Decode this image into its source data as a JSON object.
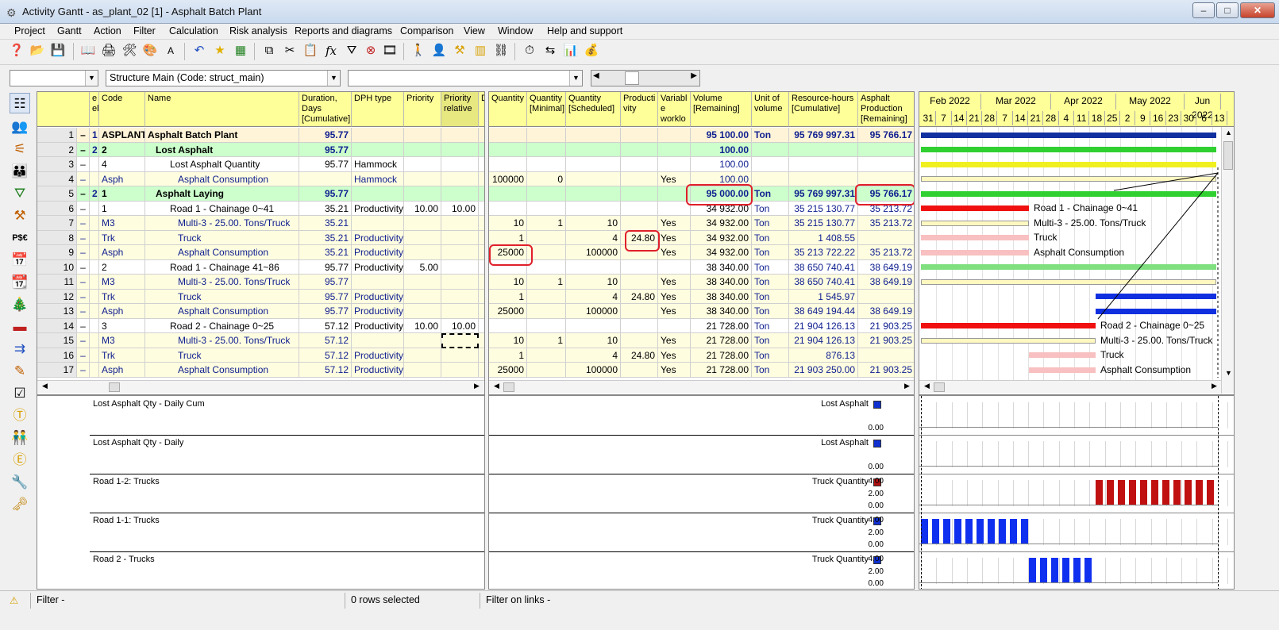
{
  "window": {
    "title": "Activity Gantt - as_plant_02 [1] - Asphalt Batch Plant",
    "min": "–",
    "max": "□",
    "close": "✕"
  },
  "menu": [
    "Project",
    "Gantt",
    "Action",
    "Filter",
    "Calculation",
    "Risk analysis",
    "Reports and diagrams",
    "Comparison",
    "View",
    "Window",
    "Help and support"
  ],
  "combos": {
    "first": "",
    "structure": "Structure Main (Code: struct_main)",
    "third": ""
  },
  "left_headers": {
    "lvl": "e\nel",
    "code": "Code",
    "name": "Name",
    "dur": "Duration,\nDays\n[Cumulative]",
    "dph": "DPH type",
    "prio": "Priority",
    "prio_rel": "Priority\nrelative",
    "d": "D"
  },
  "mid_headers": {
    "qty": "Quantity",
    "qmin": "Quantity\n[Minimal]",
    "qsch": "Quantity\n[Scheduled]",
    "prod": "Producti\nvity",
    "var": "Variabl\ne\nworklo",
    "vol": "Volume\n[Remaining]",
    "unit": "Unit of\nvolume",
    "rh": "Resource-hours\n[Cumulative]",
    "ap": "Asphalt\nProduction\n[Remaining]"
  },
  "gantt": {
    "months": [
      "Feb 2022",
      "Mar 2022",
      "Apr 2022",
      "May 2022",
      "Jun 2022"
    ],
    "days": [
      "31",
      "7",
      "14",
      "21",
      "28",
      "7",
      "14",
      "21",
      "28",
      "4",
      "11",
      "18",
      "25",
      "2",
      "9",
      "16",
      "23",
      "30",
      "6",
      "13"
    ]
  },
  "rows": [
    {
      "n": "1",
      "lvl": "1",
      "c": "ASPLANT",
      "name": "Asphalt Batch Plant",
      "dur": "95.77",
      "dph": "",
      "p": "",
      "pr": "",
      "q": "",
      "qm": "",
      "qs": "",
      "pv": "",
      "v": "",
      "vol": "95 100.00",
      "u": "Ton",
      "rh": "95 769 997.31",
      "ap": "95 766.17"
    },
    {
      "n": "2",
      "lvl": "2",
      "c": "2",
      "name": "Lost Asphalt",
      "dur": "95.77",
      "dph": "",
      "p": "",
      "pr": "",
      "q": "",
      "qm": "",
      "qs": "",
      "pv": "",
      "v": "",
      "vol": "100.00",
      "u": "",
      "rh": "",
      "ap": ""
    },
    {
      "n": "3",
      "lvl": "",
      "c": "4",
      "name": "Lost Asphalt Quantity",
      "dur": "95.77",
      "dph": "Hammock",
      "p": "",
      "pr": "",
      "q": "",
      "qm": "",
      "qs": "",
      "pv": "",
      "v": "",
      "vol": "100.00",
      "u": "",
      "rh": "",
      "ap": ""
    },
    {
      "n": "4",
      "lvl": "",
      "c": "Asph",
      "name": "Asphalt Consumption",
      "dur": "",
      "dph": "Hammock",
      "p": "",
      "pr": "",
      "q": "100000",
      "qm": "0",
      "qs": "",
      "pv": "",
      "v": "Yes",
      "vol": "100.00",
      "u": "",
      "rh": "",
      "ap": ""
    },
    {
      "n": "5",
      "lvl": "2",
      "c": "1",
      "name": "Asphalt Laying",
      "dur": "95.77",
      "dph": "",
      "p": "",
      "pr": "",
      "q": "",
      "qm": "",
      "qs": "",
      "pv": "",
      "v": "",
      "vol": "95 000.00",
      "u": "Ton",
      "rh": "95 769 997.31",
      "ap": "95 766.17"
    },
    {
      "n": "6",
      "lvl": "",
      "c": "1",
      "name": "Road 1 - Chainage 0~41",
      "dur": "35.21",
      "dph": "Productivity",
      "p": "10.00",
      "pr": "10.00",
      "q": "",
      "qm": "",
      "qs": "",
      "pv": "",
      "v": "",
      "vol": "34 932.00",
      "u": "Ton",
      "rh": "35 215 130.77",
      "ap": "35 213.72"
    },
    {
      "n": "7",
      "lvl": "",
      "c": "M3",
      "name": "Multi-3 - 25.00. Tons/Truck",
      "dur": "35.21",
      "dph": "",
      "p": "",
      "pr": "",
      "q": "10",
      "qm": "1",
      "qs": "10",
      "pv": "",
      "v": "Yes",
      "vol": "34 932.00",
      "u": "Ton",
      "rh": "35 215 130.77",
      "ap": "35 213.72"
    },
    {
      "n": "8",
      "lvl": "",
      "c": "Trk",
      "name": "Truck",
      "dur": "35.21",
      "dph": "Productivity",
      "p": "",
      "pr": "",
      "q": "1",
      "qm": "",
      "qs": "4",
      "pv": "24.80",
      "v": "Yes",
      "vol": "34 932.00",
      "u": "Ton",
      "rh": "1 408.55",
      "ap": ""
    },
    {
      "n": "9",
      "lvl": "",
      "c": "Asph",
      "name": "Asphalt Consumption",
      "dur": "35.21",
      "dph": "Productivity",
      "p": "",
      "pr": "",
      "q": "25000",
      "qm": "",
      "qs": "100000",
      "pv": "",
      "v": "Yes",
      "vol": "34 932.00",
      "u": "Ton",
      "rh": "35 213 722.22",
      "ap": "35 213.72"
    },
    {
      "n": "10",
      "lvl": "",
      "c": "2",
      "name": "Road 1 - Chainage 41~86",
      "dur": "95.77",
      "dph": "Productivity",
      "p": "5.00",
      "pr": "",
      "q": "",
      "qm": "",
      "qs": "",
      "pv": "",
      "v": "",
      "vol": "38 340.00",
      "u": "Ton",
      "rh": "38 650 740.41",
      "ap": "38 649.19"
    },
    {
      "n": "11",
      "lvl": "",
      "c": "M3",
      "name": "Multi-3 - 25.00. Tons/Truck",
      "dur": "95.77",
      "dph": "",
      "p": "",
      "pr": "",
      "q": "10",
      "qm": "1",
      "qs": "10",
      "pv": "",
      "v": "Yes",
      "vol": "38 340.00",
      "u": "Ton",
      "rh": "38 650 740.41",
      "ap": "38 649.19"
    },
    {
      "n": "12",
      "lvl": "",
      "c": "Trk",
      "name": "Truck",
      "dur": "95.77",
      "dph": "Productivity",
      "p": "",
      "pr": "",
      "q": "1",
      "qm": "",
      "qs": "4",
      "pv": "24.80",
      "v": "Yes",
      "vol": "38 340.00",
      "u": "Ton",
      "rh": "1 545.97",
      "ap": ""
    },
    {
      "n": "13",
      "lvl": "",
      "c": "Asph",
      "name": "Asphalt Consumption",
      "dur": "95.77",
      "dph": "Productivity",
      "p": "",
      "pr": "",
      "q": "25000",
      "qm": "",
      "qs": "100000",
      "pv": "",
      "v": "Yes",
      "vol": "38 340.00",
      "u": "Ton",
      "rh": "38 649 194.44",
      "ap": "38 649.19"
    },
    {
      "n": "14",
      "lvl": "",
      "c": "3",
      "name": "Road 2 - Chainage 0~25",
      "dur": "57.12",
      "dph": "Productivity",
      "p": "10.00",
      "pr": "10.00",
      "q": "",
      "qm": "",
      "qs": "",
      "pv": "",
      "v": "",
      "vol": "21 728.00",
      "u": "Ton",
      "rh": "21 904 126.13",
      "ap": "21 903.25"
    },
    {
      "n": "15",
      "lvl": "",
      "c": "M3",
      "name": "Multi-3 - 25.00. Tons/Truck",
      "dur": "57.12",
      "dph": "",
      "p": "",
      "pr": "",
      "q": "10",
      "qm": "1",
      "qs": "10",
      "pv": "",
      "v": "Yes",
      "vol": "21 728.00",
      "u": "Ton",
      "rh": "21 904 126.13",
      "ap": "21 903.25"
    },
    {
      "n": "16",
      "lvl": "",
      "c": "Trk",
      "name": "Truck",
      "dur": "57.12",
      "dph": "Productivity",
      "p": "",
      "pr": "",
      "q": "1",
      "qm": "",
      "qs": "4",
      "pv": "24.80",
      "v": "Yes",
      "vol": "21 728.00",
      "u": "Ton",
      "rh": "876.13",
      "ap": ""
    },
    {
      "n": "17",
      "lvl": "",
      "c": "Asph",
      "name": "Asphalt Consumption",
      "dur": "57.12",
      "dph": "Productivity",
      "p": "",
      "pr": "",
      "q": "25000",
      "qm": "",
      "qs": "100000",
      "pv": "",
      "v": "Yes",
      "vol": "21 728.00",
      "u": "Ton",
      "rh": "21 903 250.00",
      "ap": "21 903.25"
    }
  ],
  "gantt_labels": {
    "r6": "Road 1 - Chainage 0~41",
    "r7": "Multi-3 - 25.00. Tons/Truck",
    "r8": "Truck",
    "r9": "Asphalt Consumption",
    "r14": "Road 2 - Chainage 0~25",
    "r15": "Multi-3 - 25.00. Tons/Truck",
    "r16": "Truck",
    "r17": "Asphalt Consumption"
  },
  "histograms": [
    {
      "title": "Lost Asphalt Qty - Daily Cum",
      "legend": "Lost Asphalt",
      "color": "#1030d0",
      "ticks": [
        "0.00"
      ]
    },
    {
      "title": "Lost Asphalt Qty - Daily",
      "legend": "Lost Asphalt",
      "color": "#1030d0",
      "ticks": [
        "0.00"
      ]
    },
    {
      "title": "Road 1-2: Trucks",
      "legend": "Truck Quantity",
      "color": "#b01010",
      "ticks": [
        "4.00",
        "2.00",
        "0.00"
      ]
    },
    {
      "title": "Road 1-1: Trucks",
      "legend": "Truck Quantity",
      "color": "#1030d0",
      "ticks": [
        "4.00",
        "2.00",
        "0.00"
      ]
    },
    {
      "title": "Road 2 - Trucks",
      "legend": "Truck Quantity",
      "color": "#1030d0",
      "ticks": [
        "4.00",
        "2.00",
        "0.00"
      ]
    }
  ],
  "status": {
    "filter": "Filter -",
    "rows": "0 rows selected",
    "links": "Filter on links -"
  }
}
